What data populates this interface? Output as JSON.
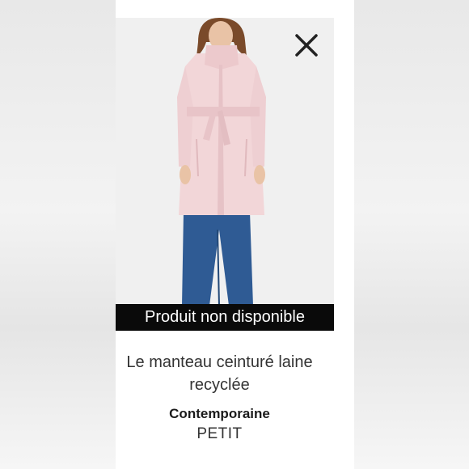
{
  "product": {
    "availability_banner": "Produit non disponible",
    "name": "Le manteau ceinturé laine recyclée",
    "brand": "Contemporaine",
    "size_label": "PETIT",
    "image": {
      "subject": "model-wearing-pink-belted-wool-coat-and-flared-jeans",
      "coat_color": "#f2d6d8",
      "jeans_color": "#2f5b94",
      "background_color": "#f0f0f0"
    }
  },
  "controls": {
    "close_icon": "close-icon"
  }
}
